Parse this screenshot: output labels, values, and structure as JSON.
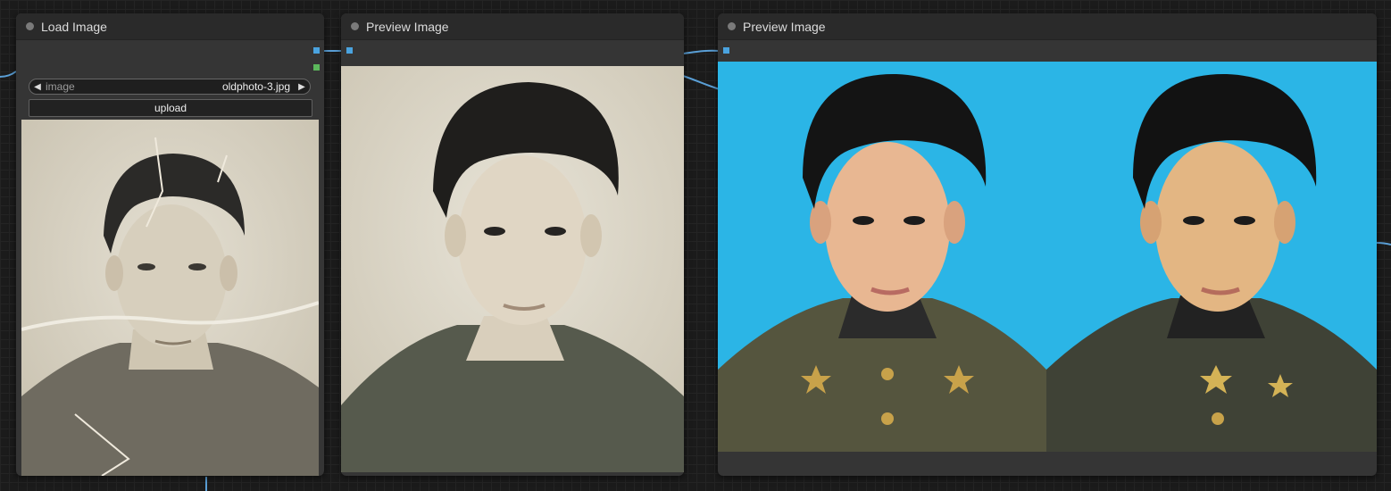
{
  "nodes": {
    "load": {
      "title": "Load Image",
      "image_widget": {
        "label": "image",
        "value": "oldphoto-3.jpg",
        "prev_icon": "◀",
        "next_icon": "▶"
      },
      "upload_label": "upload"
    },
    "preview1": {
      "title": "Preview Image"
    },
    "preview2": {
      "title": "Preview Image"
    }
  },
  "colors": {
    "input_slot": "#4aa3df",
    "mask_slot": "#5cb85c",
    "wire": "#5a9fd6",
    "photo_background_blue": "#2bb5e6"
  }
}
